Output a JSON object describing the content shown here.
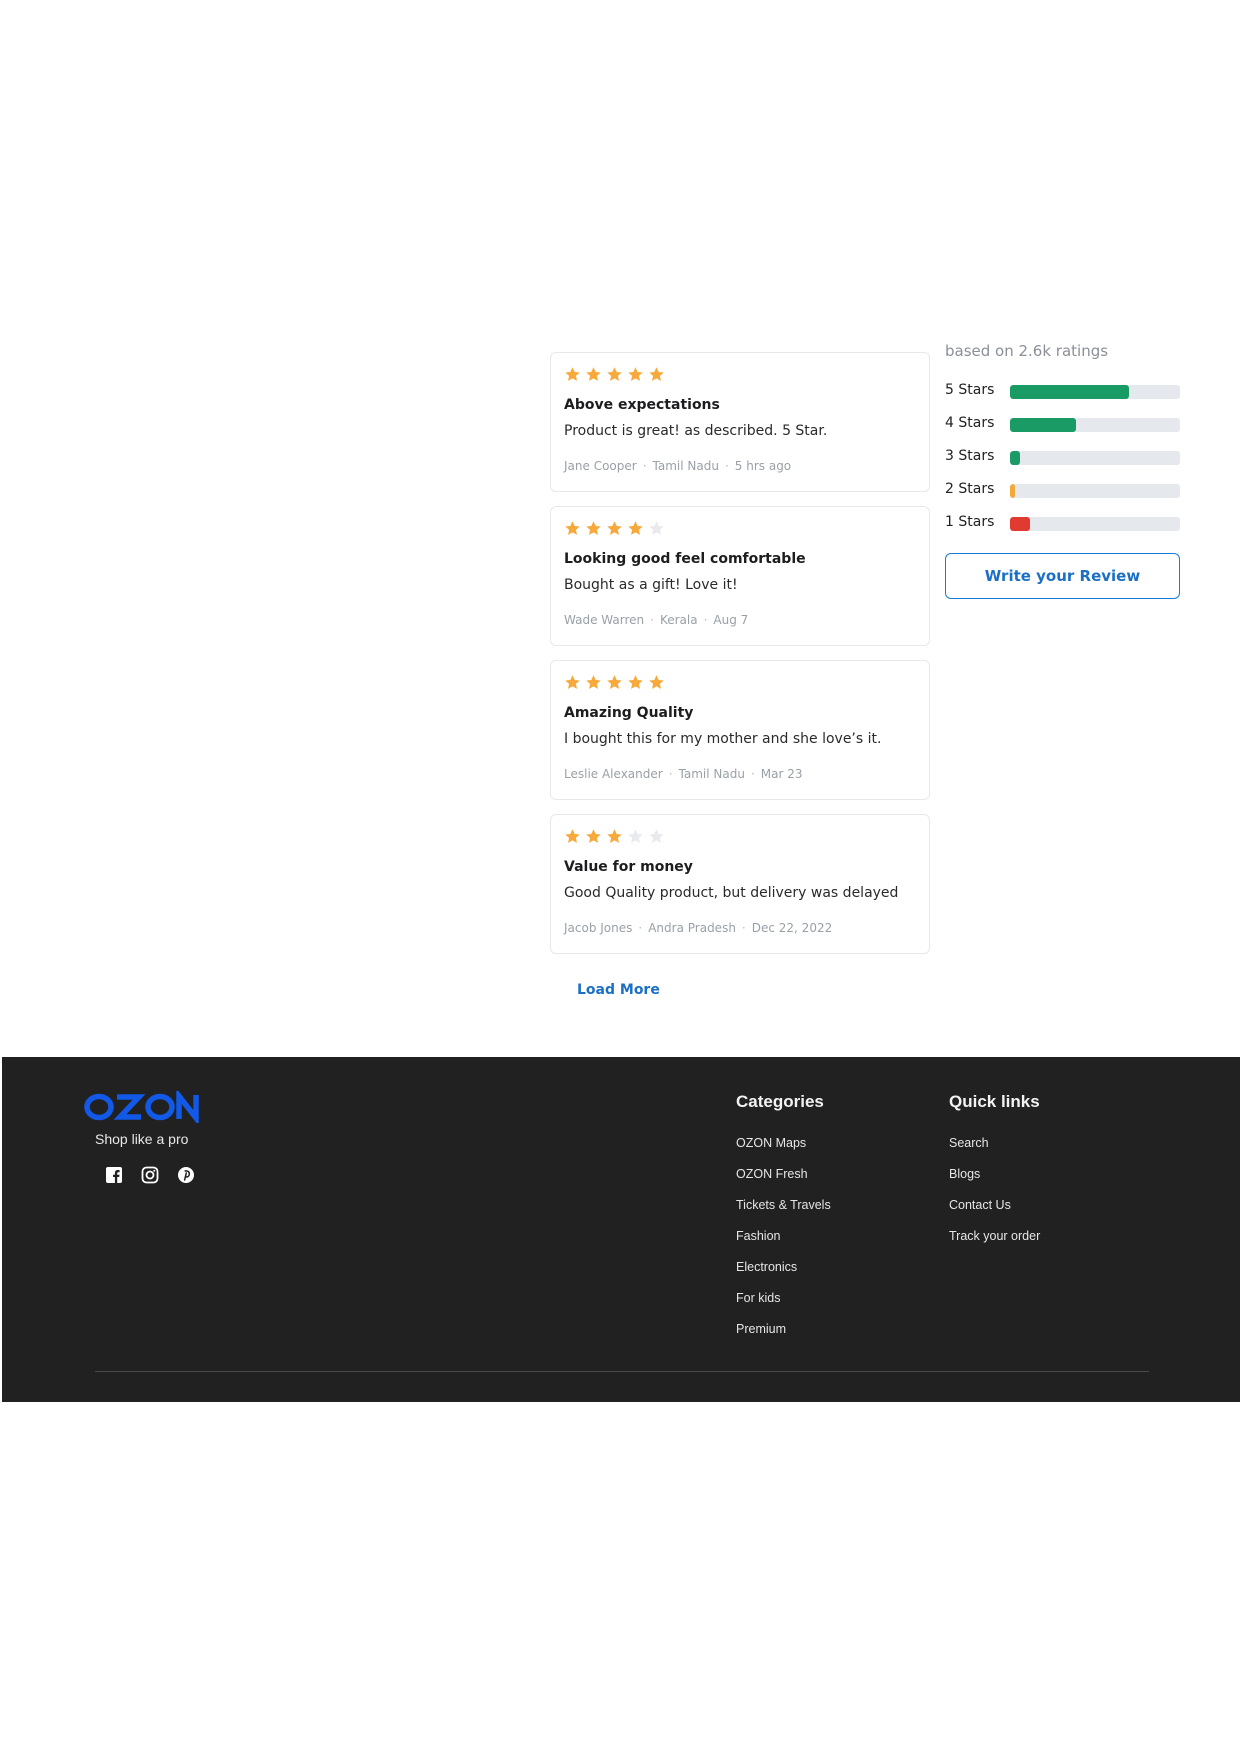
{
  "summary": {
    "based_on": "based on 2.6k ratings",
    "rows": [
      {
        "label": "5 Stars",
        "fraction": 0.7,
        "color": "#1a9a64"
      },
      {
        "label": "4 Stars",
        "fraction": 0.39,
        "color": "#1a9a64"
      },
      {
        "label": "3 Stars",
        "fraction": 0.06,
        "color": "#1a9a64"
      },
      {
        "label": "2 Stars",
        "fraction": 0.03,
        "color": "#f2a93b"
      },
      {
        "label": "1 Stars",
        "fraction": 0.12,
        "color": "#e03a31"
      }
    ],
    "write_review": "Write your Review"
  },
  "reviews": [
    {
      "rating": 5,
      "title": "Above expectations",
      "body": "Product is great! as described. 5 Star.",
      "author": "Jane Cooper",
      "location": "Tamil Nadu",
      "time": "5 hrs ago"
    },
    {
      "rating": 4,
      "title": "Looking good feel comfortable",
      "body": "Bought as a gift! Love it!",
      "author": "Wade Warren",
      "location": "Kerala",
      "time": "Aug 7"
    },
    {
      "rating": 5,
      "title": "Amazing  Quality",
      "body": "I bought this for my mother and she love’s it.",
      "author": "Leslie Alexander",
      "location": "Tamil Nadu",
      "time": "Mar 23"
    },
    {
      "rating": 3,
      "title": "Value for money",
      "body": "Good Quality product, but delivery was delayed",
      "author": "Jacob Jones",
      "location": "Andra Pradesh",
      "time": "Dec 22, 2022"
    }
  ],
  "load_more": "Load More",
  "footer": {
    "logo": "OZON",
    "tagline": "Shop like a pro",
    "socials": [
      "facebook-icon",
      "instagram-icon",
      "pinterest-icon"
    ],
    "categories": {
      "title": "Categories",
      "items": [
        "OZON Maps",
        "OZON  Fresh",
        "Tickets & Travels",
        "Fashion",
        "Electronics",
        "For kids",
        "Premium"
      ]
    },
    "quick_links": {
      "title": "Quick links",
      "items": [
        "Search",
        "Blogs",
        "Contact Us",
        "Track your order"
      ]
    }
  },
  "colors": {
    "star_filled": "#f7a93b",
    "star_empty": "#e8eaee",
    "accent_blue": "#1b6fc4",
    "logo_blue": "#1159e6",
    "footer_bg": "#212121"
  }
}
